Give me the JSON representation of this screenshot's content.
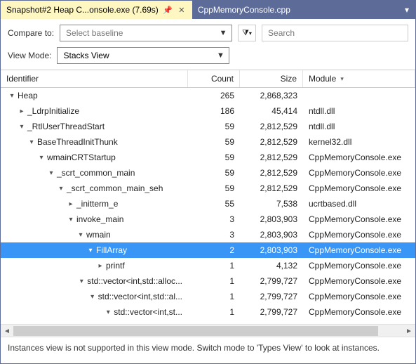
{
  "tabs": {
    "active": "Snapshot#2 Heap C...onsole.exe (7.69s)",
    "inactive": "CppMemoryConsole.cpp"
  },
  "toolbar": {
    "compare_label": "Compare to:",
    "baseline_placeholder": "Select baseline",
    "viewmode_label": "View Mode:",
    "viewmode_value": "Stacks View",
    "search_placeholder": "Search",
    "filter_glyph": "▼"
  },
  "columns": {
    "identifier": "Identifier",
    "count": "Count",
    "size": "Size",
    "module": "Module"
  },
  "rows": [
    {
      "indent": 0,
      "exp": "▾",
      "label": "Heap",
      "count": "265",
      "size": "2,868,323",
      "module": "",
      "sel": false
    },
    {
      "indent": 1,
      "exp": "▸",
      "label": "_LdrpInitialize",
      "count": "186",
      "size": "45,414",
      "module": "ntdll.dll",
      "sel": false
    },
    {
      "indent": 1,
      "exp": "▾",
      "label": "_RtlUserThreadStart",
      "count": "59",
      "size": "2,812,529",
      "module": "ntdll.dll",
      "sel": false
    },
    {
      "indent": 2,
      "exp": "▾",
      "label": "BaseThreadInitThunk",
      "count": "59",
      "size": "2,812,529",
      "module": "kernel32.dll",
      "sel": false
    },
    {
      "indent": 3,
      "exp": "▾",
      "label": "wmainCRTStartup",
      "count": "59",
      "size": "2,812,529",
      "module": "CppMemoryConsole.exe",
      "sel": false
    },
    {
      "indent": 4,
      "exp": "▾",
      "label": "_scrt_common_main",
      "count": "59",
      "size": "2,812,529",
      "module": "CppMemoryConsole.exe",
      "sel": false
    },
    {
      "indent": 5,
      "exp": "▾",
      "label": "_scrt_common_main_seh",
      "count": "59",
      "size": "2,812,529",
      "module": "CppMemoryConsole.exe",
      "sel": false
    },
    {
      "indent": 6,
      "exp": "▸",
      "label": "_initterm_e",
      "count": "55",
      "size": "7,538",
      "module": "ucrtbased.dll",
      "sel": false
    },
    {
      "indent": 6,
      "exp": "▾",
      "label": "invoke_main",
      "count": "3",
      "size": "2,803,903",
      "module": "CppMemoryConsole.exe",
      "sel": false
    },
    {
      "indent": 7,
      "exp": "▾",
      "label": "wmain",
      "count": "3",
      "size": "2,803,903",
      "module": "CppMemoryConsole.exe",
      "sel": false
    },
    {
      "indent": 8,
      "exp": "▾",
      "label": "FillArray",
      "count": "2",
      "size": "2,803,903",
      "module": "CppMemoryConsole.exe",
      "sel": true
    },
    {
      "indent": 9,
      "exp": "▸",
      "label": "printf",
      "count": "1",
      "size": "4,132",
      "module": "CppMemoryConsole.exe",
      "sel": false
    },
    {
      "indent": 9,
      "exp": "▾",
      "label": "std::vector<int,std::alloc...",
      "count": "1",
      "size": "2,799,727",
      "module": "CppMemoryConsole.exe",
      "sel": false
    },
    {
      "indent": 10,
      "exp": "▾",
      "label": "std::vector<int,std::al...",
      "count": "1",
      "size": "2,799,727",
      "module": "CppMemoryConsole.exe",
      "sel": false
    },
    {
      "indent": 11,
      "exp": "▾",
      "label": "std::vector<int,st...",
      "count": "1",
      "size": "2,799,727",
      "module": "CppMemoryConsole.exe",
      "sel": false
    }
  ],
  "status": "Instances view is not supported in this view mode. Switch mode to 'Types View' to look at instances."
}
